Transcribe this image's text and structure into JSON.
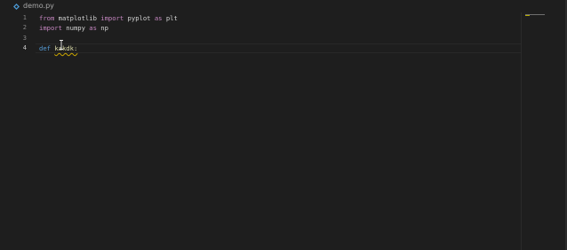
{
  "tab": {
    "file_name": "demo.py",
    "icon": "python-file-icon"
  },
  "gutter": {
    "line_numbers": [
      "1",
      "2",
      "3",
      "4"
    ]
  },
  "code": {
    "line1": {
      "kw1": "from",
      "mod": "matplotlib",
      "kw2": "import",
      "name": "pyplot",
      "kw3": "as",
      "alias": "plt"
    },
    "line2": {
      "kw1": "import",
      "mod": "numpy",
      "kw2": "as",
      "alias": "np"
    },
    "line3": {
      "text": ""
    },
    "line4": {
      "kw": "def",
      "name": "kakdk:"
    }
  },
  "colors": {
    "background": "#1e1e1e",
    "keyword_pink": "#c586c0",
    "keyword_blue": "#569cd6",
    "function": "#dcdcaa",
    "warning_squiggle": "#cca700"
  }
}
